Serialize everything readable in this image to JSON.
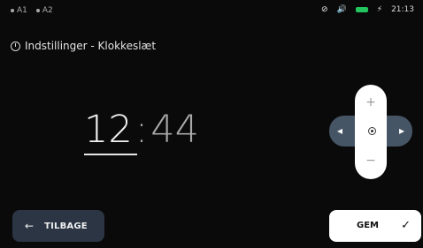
{
  "statusbar": {
    "left_items": [
      "A1",
      "A2"
    ],
    "icons": [
      "no-internet-icon",
      "volume-icon",
      "battery-icon",
      "power-icon"
    ],
    "time": "21:13",
    "colors": {
      "battery": "#22c55e"
    }
  },
  "header": {
    "title": "Indstillinger - Klokkeslæt"
  },
  "time": {
    "hours": "12",
    "separator": ":",
    "minutes": "44"
  },
  "dpad": {
    "up": "+",
    "down": "−",
    "left": "◂",
    "right": "▸"
  },
  "buttons": {
    "back": {
      "arrow": "←",
      "label": "TILBAGE"
    },
    "save": {
      "label": "GEM",
      "check": "✓"
    }
  },
  "colors": {
    "background": "#0a0a0a",
    "back_button": "#2b3543",
    "dpad_horizontal": "#465565"
  }
}
